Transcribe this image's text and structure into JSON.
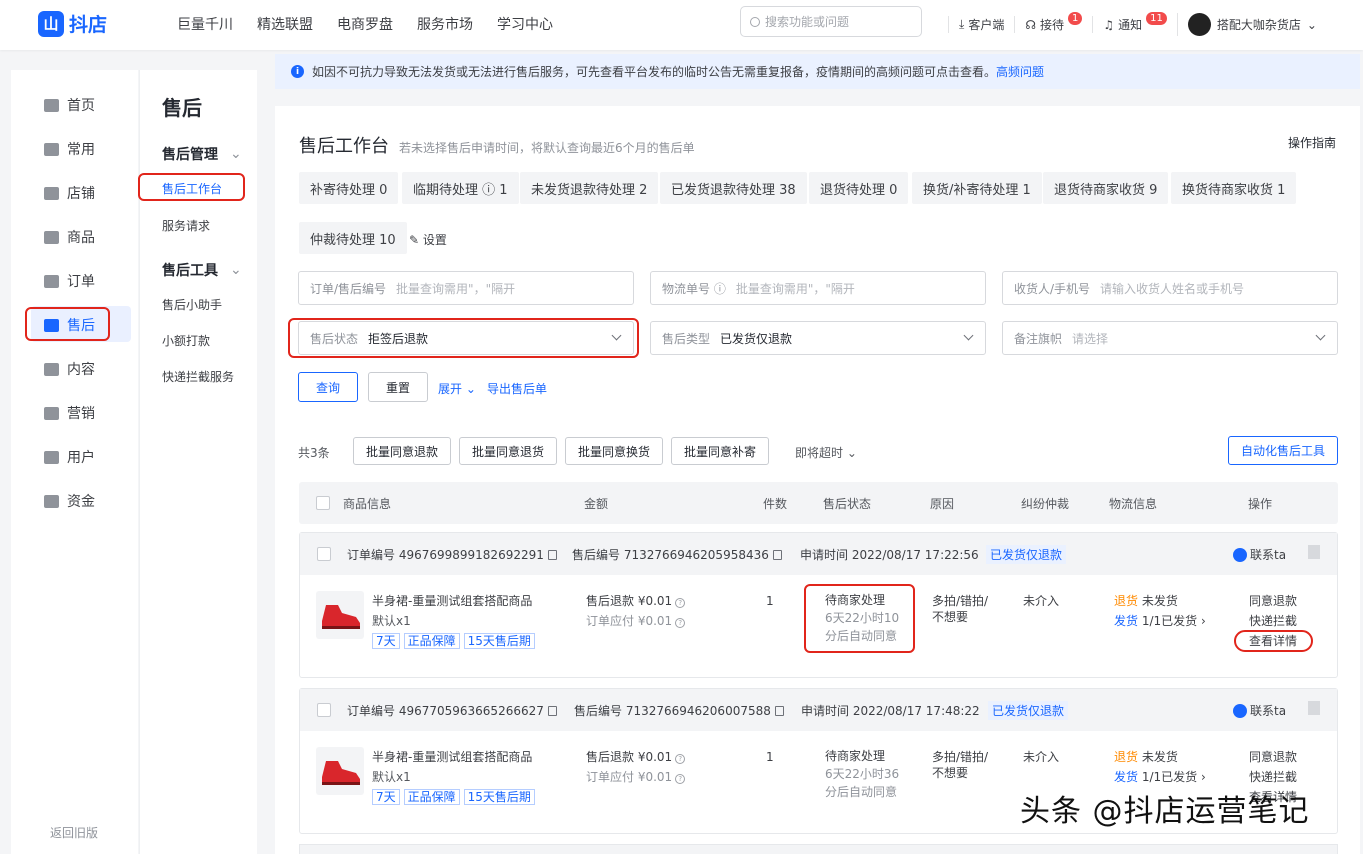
{
  "brand": {
    "logo_glyph": "山",
    "name": "抖店",
    "color": "#1966ff"
  },
  "topnav": [
    "巨量千川",
    "精选联盟",
    "电商罗盘",
    "服务市场",
    "学习中心"
  ],
  "search": {
    "placeholder": "搜索功能或问题"
  },
  "topright": {
    "client": "客户端",
    "reception": "接待",
    "reception_badge": "1",
    "notice": "通知",
    "notice_badge": "11",
    "shop": "搭配大咖杂货店"
  },
  "leftnav": {
    "items": [
      "首页",
      "常用",
      "店铺",
      "商品",
      "订单",
      "售后",
      "内容",
      "营销",
      "用户",
      "资金"
    ],
    "active": "售后",
    "footer": "返回旧版"
  },
  "subnav": {
    "title": "售后",
    "group1": "售后管理",
    "group1_items": [
      "售后工作台",
      "服务请求"
    ],
    "group2": "售后工具",
    "group2_items": [
      "售后小助手",
      "小额打款",
      "快递拦截服务"
    ]
  },
  "notice": {
    "text": "如因不可抗力导致无法发货或无法进行售后服务，可先查看平台发布的临时公告无需重复报备，疫情期间的高频问题可点击查看。",
    "link": "高频问题"
  },
  "page": {
    "title": "售后工作台",
    "subtitle": "若未选择售后申请时间，将默认查询最近6个月的售后单",
    "guide": "操作指南"
  },
  "chips": [
    "补寄待处理 0",
    "临期待处理 ⓘ 1",
    "未发货退款待处理 2",
    "已发货退款待处理 38",
    "退货待处理 0",
    "换货/补寄待处理 1",
    "退货待商家收货 9",
    "换货待商家收货 1",
    "仲裁待处理 10"
  ],
  "settings": "设置",
  "filters": {
    "order_no": {
      "label": "订单/售后编号",
      "placeholder": "批量查询需用\"，\"隔开"
    },
    "logistics": {
      "label": "物流单号 ⓘ",
      "placeholder": "批量查询需用\"，\"隔开"
    },
    "receiver": {
      "label": "收货人/手机号",
      "placeholder": "请输入收货人姓名或手机号"
    },
    "status": {
      "label": "售后状态",
      "value": "拒签后退款"
    },
    "type": {
      "label": "售后类型",
      "value": "已发货仅退款"
    },
    "flag": {
      "label": "备注旗帜",
      "placeholder": "请选择"
    }
  },
  "actions": {
    "query": "查询",
    "reset": "重置",
    "expand": "展开",
    "export": "导出售后单"
  },
  "batch": {
    "count": "共3条",
    "agree_refund": "批量同意退款",
    "agree_return": "批量同意退货",
    "agree_exchange": "批量同意换货",
    "agree_resend": "批量同意补寄",
    "timeout": "即将超时",
    "auto_tool": "自动化售后工具"
  },
  "columns": [
    "商品信息",
    "金额",
    "件数",
    "售后状态",
    "原因",
    "纠纷仲裁",
    "物流信息",
    "操作"
  ],
  "orders": [
    {
      "order_no": "订单编号 4967699899182692291",
      "aftersale_no": "售后编号 7132766946205958436",
      "apply_time": "申请时间 2022/08/17 17:22:56",
      "type_tag": "已发货仅退款",
      "contact": "联系ta",
      "product": "半身裙-重量测试组套搭配商品",
      "spec": "默认x1",
      "tags": [
        "7天",
        "正品保障",
        "15天售后期"
      ],
      "refund": "售后退款 ¥0.01",
      "payable": "订单应付 ¥0.01",
      "qty": "1",
      "status": "待商家处理",
      "status_sub1": "6天22小时10",
      "status_sub2": "分后自动同意",
      "reason1": "多拍/错拍/",
      "reason2": "不想要",
      "dispute": "未介入",
      "return_label": "退货",
      "return_val": "未发货",
      "ship_label": "发货",
      "ship_val": "1/1已发货 ›",
      "op1": "同意退款",
      "op2": "快递拦截",
      "op3": "查看详情"
    },
    {
      "order_no": "订单编号 4967705963665266627",
      "aftersale_no": "售后编号 7132766946206007588",
      "apply_time": "申请时间 2022/08/17 17:48:22",
      "type_tag": "已发货仅退款",
      "contact": "联系ta",
      "product": "半身裙-重量测试组套搭配商品",
      "spec": "默认x1",
      "tags": [
        "7天",
        "正品保障",
        "15天售后期"
      ],
      "refund": "售后退款 ¥0.01",
      "payable": "订单应付 ¥0.01",
      "qty": "1",
      "status": "待商家处理",
      "status_sub1": "6天22小时36",
      "status_sub2": "分后自动同意",
      "reason1": "多拍/错拍/",
      "reason2": "不想要",
      "dispute": "未介入",
      "return_label": "退货",
      "return_val": "未发货",
      "ship_label": "发货",
      "ship_val": "1/1已发货 ›",
      "op1": "同意退款",
      "op2": "快递拦截",
      "op3": "查看详情"
    }
  ],
  "watermark": "头条 @抖店运营笔记"
}
